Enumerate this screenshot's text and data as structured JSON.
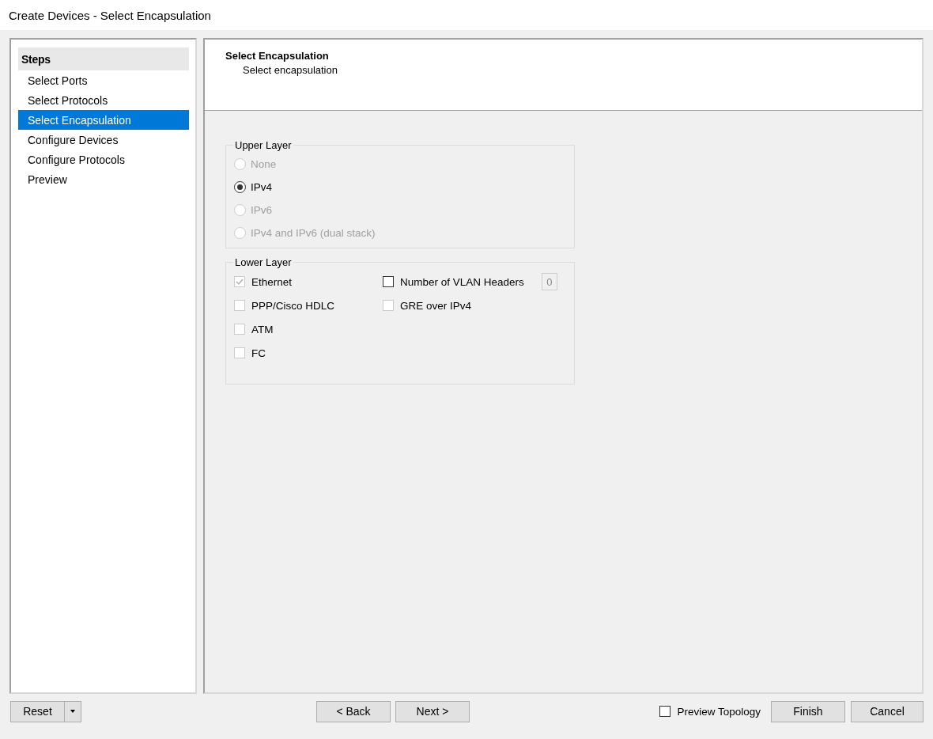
{
  "window": {
    "title": "Create Devices - Select Encapsulation"
  },
  "steps": {
    "title": "Steps",
    "items": [
      {
        "label": "Select Ports",
        "selected": false
      },
      {
        "label": "Select Protocols",
        "selected": false
      },
      {
        "label": "Select Encapsulation",
        "selected": true
      },
      {
        "label": "Configure Devices",
        "selected": false
      },
      {
        "label": "Configure Protocols",
        "selected": false
      },
      {
        "label": "Preview",
        "selected": false
      }
    ]
  },
  "header": {
    "title": "Select Encapsulation",
    "subtitle": "Select encapsulation"
  },
  "upper_layer": {
    "title": "Upper Layer",
    "options": [
      {
        "label": "None",
        "selected": false,
        "disabled": true
      },
      {
        "label": "IPv4",
        "selected": true,
        "disabled": false
      },
      {
        "label": "IPv6",
        "selected": false,
        "disabled": true
      },
      {
        "label": "IPv4 and IPv6 (dual stack)",
        "selected": false,
        "disabled": true
      }
    ]
  },
  "lower_layer": {
    "title": "Lower Layer",
    "left": [
      {
        "label": "Ethernet",
        "checked": true,
        "disabled": true
      },
      {
        "label": "PPP/Cisco HDLC",
        "checked": false,
        "disabled": true
      },
      {
        "label": "ATM",
        "checked": false,
        "disabled": true
      },
      {
        "label": "FC",
        "checked": false,
        "disabled": true
      }
    ],
    "right": [
      {
        "label": "Number of VLAN Headers",
        "checked": false,
        "disabled": false,
        "value": "0"
      },
      {
        "label": "GRE over IPv4",
        "checked": false,
        "disabled": true
      }
    ]
  },
  "footer": {
    "reset": "Reset",
    "back": "< Back",
    "next": "Next >",
    "preview": {
      "label": "Preview Topology",
      "checked": false
    },
    "finish": "Finish",
    "cancel": "Cancel"
  }
}
